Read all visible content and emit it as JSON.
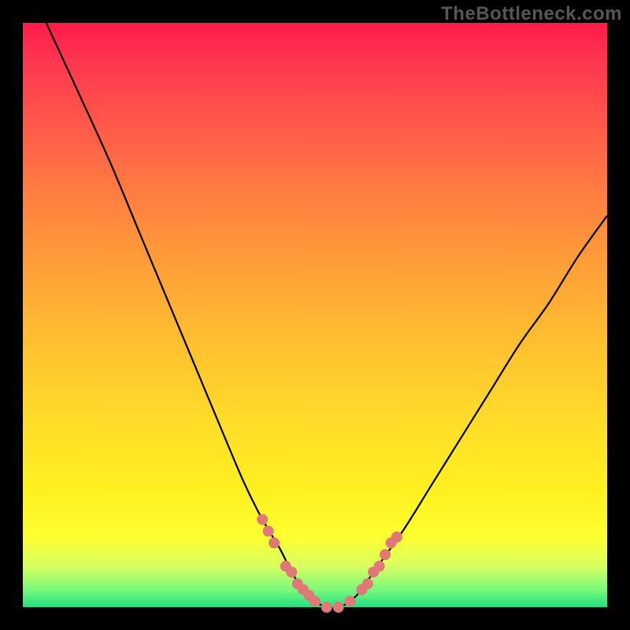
{
  "attribution": "TheBottleneck.com",
  "chart_data": {
    "type": "line",
    "title": "",
    "xlabel": "",
    "ylabel": "",
    "xlim": [
      0,
      100
    ],
    "ylim": [
      0,
      100
    ],
    "series": [
      {
        "name": "bottleneck-curve",
        "x": [
          4,
          10,
          15,
          20,
          25,
          30,
          35,
          38,
          41,
          44,
          46,
          48,
          50,
          52,
          54,
          56,
          58,
          60,
          65,
          70,
          75,
          80,
          85,
          90,
          95,
          100
        ],
        "y": [
          100,
          87,
          76,
          64,
          52,
          40,
          28,
          21,
          15,
          10,
          6,
          3,
          1,
          0,
          0,
          1,
          3,
          6,
          13,
          21,
          29,
          37,
          45,
          52,
          60,
          67
        ]
      }
    ],
    "markers": {
      "name": "highlight-dots",
      "color": "#e07878",
      "points": [
        {
          "x": 41,
          "y": 15
        },
        {
          "x": 42,
          "y": 13
        },
        {
          "x": 43,
          "y": 11
        },
        {
          "x": 45,
          "y": 7
        },
        {
          "x": 46,
          "y": 6
        },
        {
          "x": 47,
          "y": 4
        },
        {
          "x": 48,
          "y": 3
        },
        {
          "x": 49,
          "y": 2
        },
        {
          "x": 50,
          "y": 1
        },
        {
          "x": 52,
          "y": 0
        },
        {
          "x": 54,
          "y": 0
        },
        {
          "x": 56,
          "y": 1
        },
        {
          "x": 58,
          "y": 3
        },
        {
          "x": 59,
          "y": 4
        },
        {
          "x": 60,
          "y": 6
        },
        {
          "x": 61,
          "y": 7
        },
        {
          "x": 62,
          "y": 9
        },
        {
          "x": 63,
          "y": 11
        },
        {
          "x": 64,
          "y": 12
        }
      ]
    }
  }
}
